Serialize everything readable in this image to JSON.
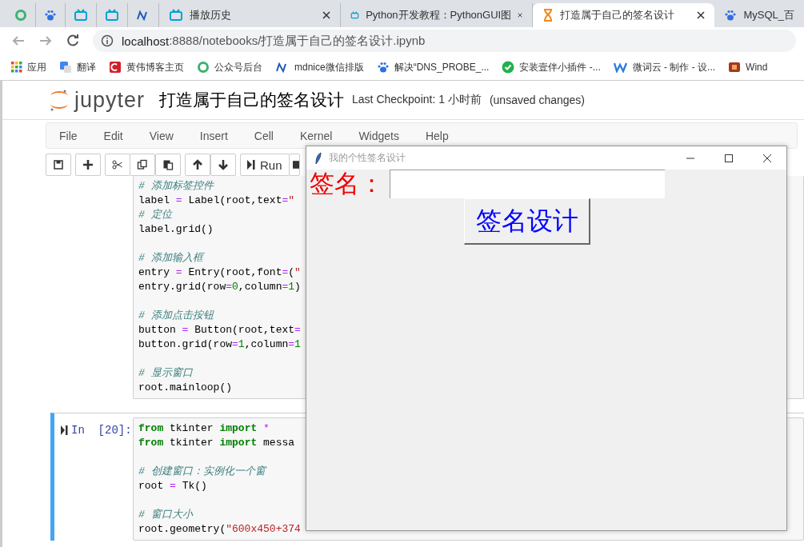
{
  "browser": {
    "tabs": [
      {
        "selected": false
      },
      {
        "selected": false
      },
      {
        "selected": false
      },
      {
        "selected": false
      },
      {
        "selected": false
      },
      {
        "label": "播放历史",
        "selected": false
      },
      {
        "label": "Python开发教程：PythonGUI图",
        "selected": false
      },
      {
        "label": "打造属于自己的签名设计",
        "selected": true
      },
      {
        "label": "MySQL_百",
        "selected": false
      }
    ],
    "address": {
      "host": "localhost",
      "rest": ":8888/notebooks/打造属于自己的签名设计.ipynb"
    },
    "bookmarks": [
      "应用",
      "翻译",
      "黄伟博客主页",
      "公众号后台",
      "mdnice微信排版",
      "解决“DNS_PROBE_...",
      "安装壹伴小插件 -...",
      "微词云 - 制作 - 设...",
      "Wind"
    ]
  },
  "jupyter": {
    "logo": "jupyter",
    "notebook_title": "打造属于自己的签名设计",
    "checkpoint": "Last Checkpoint: 1 小时前",
    "unsaved": "(unsaved changes)",
    "menu": [
      "File",
      "Edit",
      "View",
      "Insert",
      "Cell",
      "Kernel",
      "Widgets",
      "Help"
    ],
    "run_label": "Run"
  },
  "cells": [
    {
      "selected": false,
      "lines": [
        {
          "kind": "code",
          "segments": [
            {
              "kind": "comment",
              "text": "# 添加标签控件"
            }
          ]
        },
        {
          "kind": "code",
          "segments": [
            {
              "kind": "plain",
              "text": "label "
            },
            {
              "kind": "op",
              "text": "="
            },
            {
              "kind": "plain",
              "text": " Label(root,text"
            },
            {
              "kind": "op",
              "text": "="
            },
            {
              "kind": "string",
              "text": "\""
            }
          ]
        },
        {
          "kind": "code",
          "segments": [
            {
              "kind": "comment",
              "text": "# 定位"
            }
          ]
        },
        {
          "kind": "code",
          "segments": [
            {
              "kind": "plain",
              "text": "label.grid()"
            }
          ]
        },
        {
          "kind": "blank"
        },
        {
          "kind": "code",
          "segments": [
            {
              "kind": "comment",
              "text": "# 添加输入框"
            }
          ]
        },
        {
          "kind": "code",
          "segments": [
            {
              "kind": "plain",
              "text": "entry "
            },
            {
              "kind": "op",
              "text": "="
            },
            {
              "kind": "plain",
              "text": " Entry(root,font"
            },
            {
              "kind": "op",
              "text": "="
            },
            {
              "kind": "plain",
              "text": "("
            },
            {
              "kind": "string",
              "text": "\""
            }
          ]
        },
        {
          "kind": "code",
          "segments": [
            {
              "kind": "plain",
              "text": "entry.grid(row"
            },
            {
              "kind": "op",
              "text": "="
            },
            {
              "kind": "number",
              "text": "0"
            },
            {
              "kind": "plain",
              "text": ",column"
            },
            {
              "kind": "op",
              "text": "="
            },
            {
              "kind": "number",
              "text": "1"
            },
            {
              "kind": "plain",
              "text": ")"
            }
          ]
        },
        {
          "kind": "blank"
        },
        {
          "kind": "code",
          "segments": [
            {
              "kind": "comment",
              "text": "# 添加点击按钮"
            }
          ]
        },
        {
          "kind": "code",
          "segments": [
            {
              "kind": "plain",
              "text": "button "
            },
            {
              "kind": "op",
              "text": "="
            },
            {
              "kind": "plain",
              "text": " Button(root,text"
            },
            {
              "kind": "op",
              "text": "="
            }
          ]
        },
        {
          "kind": "code",
          "segments": [
            {
              "kind": "plain",
              "text": "button.grid(row"
            },
            {
              "kind": "op",
              "text": "="
            },
            {
              "kind": "number",
              "text": "1"
            },
            {
              "kind": "plain",
              "text": ",column"
            },
            {
              "kind": "op",
              "text": "="
            },
            {
              "kind": "number",
              "text": "1"
            }
          ]
        },
        {
          "kind": "blank"
        },
        {
          "kind": "code",
          "segments": [
            {
              "kind": "comment",
              "text": "# 显示窗口"
            }
          ]
        },
        {
          "kind": "code",
          "segments": [
            {
              "kind": "plain",
              "text": "root.mainloop()"
            }
          ]
        }
      ]
    },
    {
      "prompt": "In  [20]:",
      "selected": true,
      "lines": [
        {
          "kind": "code",
          "segments": [
            {
              "kind": "keyword",
              "text": "from"
            },
            {
              "kind": "plain",
              "text": " tkinter "
            },
            {
              "kind": "keyword",
              "text": "import"
            },
            {
              "kind": "op",
              "text": " *"
            }
          ]
        },
        {
          "kind": "code",
          "segments": [
            {
              "kind": "keyword",
              "text": "from"
            },
            {
              "kind": "plain",
              "text": " tkinter "
            },
            {
              "kind": "keyword",
              "text": "import"
            },
            {
              "kind": "plain",
              "text": " messa"
            }
          ]
        },
        {
          "kind": "blank"
        },
        {
          "kind": "code",
          "segments": [
            {
              "kind": "comment",
              "text": "# 创建窗口：实例化一个窗"
            }
          ]
        },
        {
          "kind": "code",
          "segments": [
            {
              "kind": "plain",
              "text": "root "
            },
            {
              "kind": "op",
              "text": "="
            },
            {
              "kind": "plain",
              "text": " Tk()"
            }
          ]
        },
        {
          "kind": "blank"
        },
        {
          "kind": "code",
          "segments": [
            {
              "kind": "comment",
              "text": "# 窗口大小"
            }
          ]
        },
        {
          "kind": "code",
          "segments": [
            {
              "kind": "plain",
              "text": "root.geometry("
            },
            {
              "kind": "string",
              "text": "\"600x450+374"
            }
          ]
        }
      ]
    }
  ],
  "tk_window": {
    "title": "我的个性签名设计",
    "label": "签名：",
    "button": "签名设计"
  }
}
